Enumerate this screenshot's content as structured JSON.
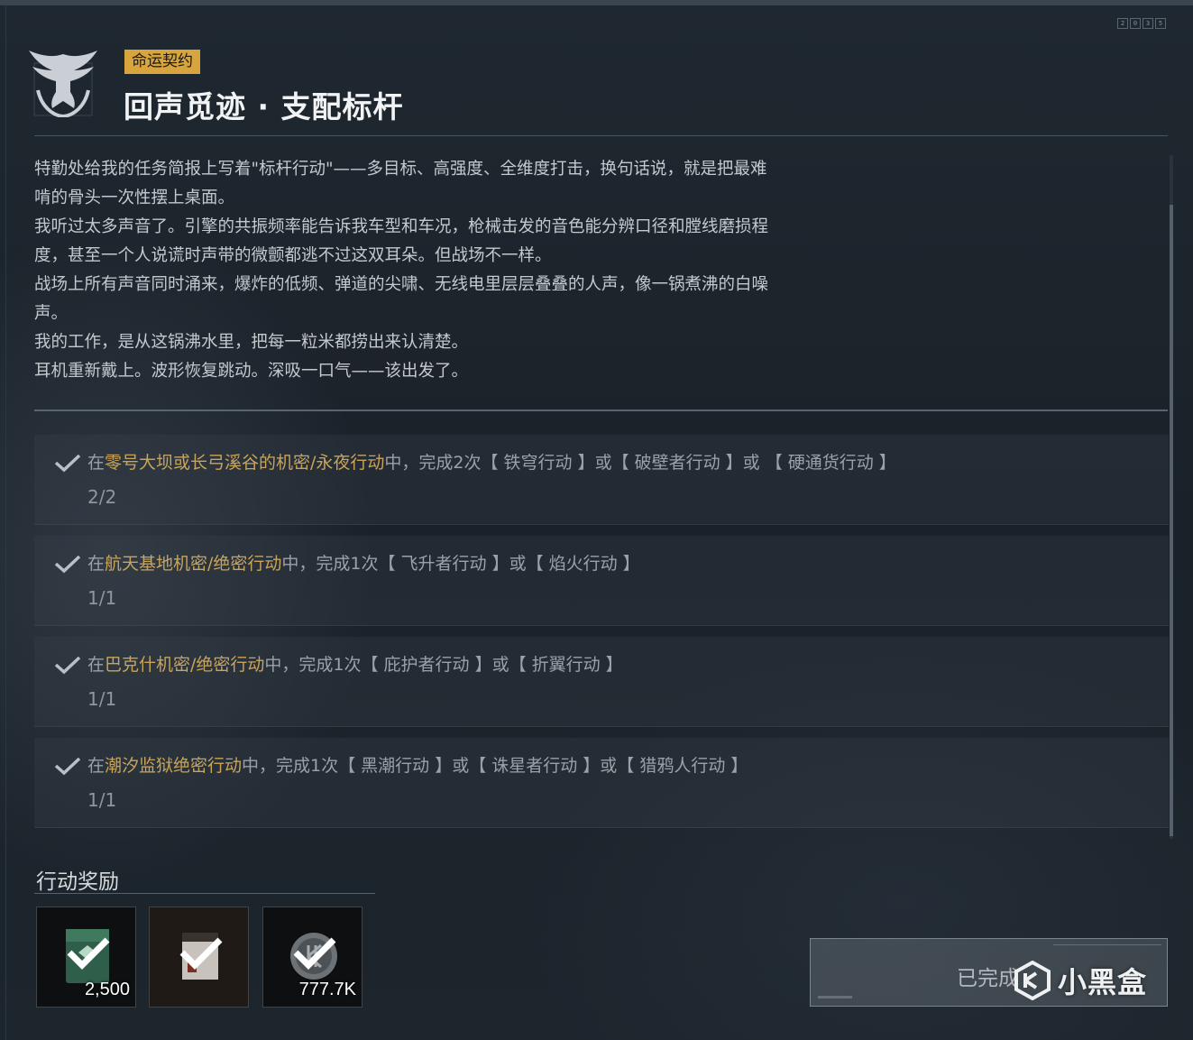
{
  "header": {
    "badge": "命运契约",
    "title": "回声觅迹 · 支配标杆",
    "corner_tag": [
      "2",
      "0",
      "3",
      "5"
    ]
  },
  "description": [
    "特勤处给我的任务简报上写着\"标杆行动\"——多目标、高强度、全维度打击，换句话说，就是把最难",
    "啃的骨头一次性摆上桌面。",
    "我听过太多声音了。引擎的共振频率能告诉我车型和车况，枪械击发的音色能分辨口径和膛线磨损程",
    "度，甚至一个人说谎时声带的微颤都逃不过这双耳朵。但战场不一样。",
    "战场上所有声音同时涌来，爆炸的低频、弹道的尖啸、无线电里层层叠叠的人声，像一锅煮沸的白噪",
    "声。",
    "我的工作，是从这锅沸水里，把每一粒米都捞出来认清楚。",
    "耳机重新戴上。波形恢复跳动。深吸一口气——该出发了。"
  ],
  "tasks": [
    {
      "prefix": "在",
      "location": "零号大坝或长弓溪谷的机密/永夜行动",
      "suffix": "中，完成2次【 铁穹行动 】或【 破壁者行动 】或 【 硬通货行动 】",
      "progress": "2/2"
    },
    {
      "prefix": "在",
      "location": "航天基地机密/绝密行动",
      "suffix": "中，完成1次【 飞升者行动 】或【 焰火行动 】",
      "progress": "1/1"
    },
    {
      "prefix": "在",
      "location": "巴克什机密/绝密行动",
      "suffix": "中，完成1次【 庇护者行动 】或【 折翼行动 】",
      "progress": "1/1"
    },
    {
      "prefix": "在",
      "location": "潮汐监狱绝密行动",
      "suffix": "中，完成1次【 黑潮行动 】或【 诛星者行动 】或【 猎鸦人行动 】",
      "progress": "1/1"
    }
  ],
  "rewards": {
    "title": "行动奖励",
    "items": [
      {
        "name": "green-case-icon",
        "qty": "2,500"
      },
      {
        "name": "barista-box-icon",
        "qty": ""
      },
      {
        "name": "coin-icon",
        "qty": "777.7K"
      }
    ]
  },
  "action": {
    "label": "已完成"
  },
  "watermark": {
    "text": "小黑盒"
  },
  "colors": {
    "badge": "#d7a43d",
    "highlight": "#c9a45a",
    "background": "#1b232c"
  }
}
